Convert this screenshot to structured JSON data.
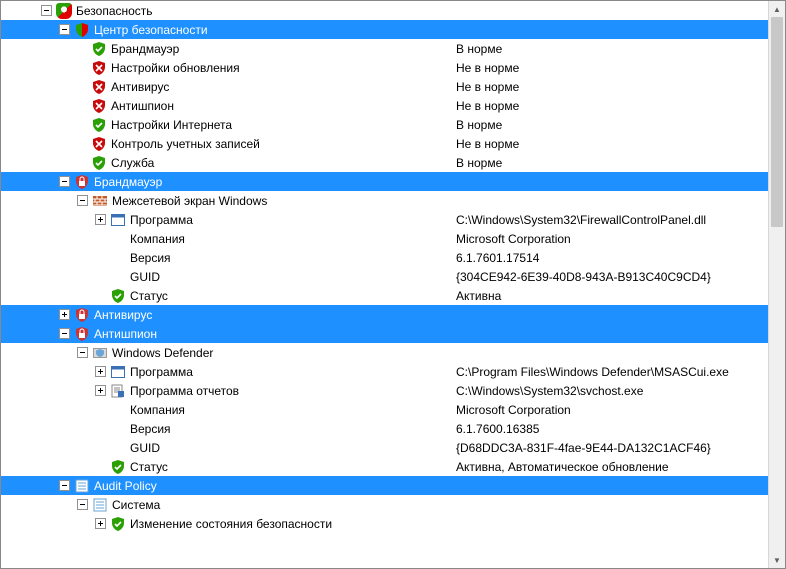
{
  "root": {
    "label": "Безопасность"
  },
  "security_center": {
    "label": "Центр безопасности",
    "items": [
      {
        "label": "Брандмауэр",
        "value": "В норме",
        "ok": true
      },
      {
        "label": "Настройки обновления",
        "value": "Не в норме",
        "ok": false
      },
      {
        "label": "Антивирус",
        "value": "Не в норме",
        "ok": false
      },
      {
        "label": "Антишпион",
        "value": "Не в норме",
        "ok": false
      },
      {
        "label": "Настройки Интернета",
        "value": "В норме",
        "ok": true
      },
      {
        "label": "Контроль учетных записей",
        "value": "Не в норме",
        "ok": false
      },
      {
        "label": "Служба",
        "value": "В норме",
        "ok": true
      }
    ]
  },
  "firewall": {
    "label": "Брандмауэр",
    "provider": {
      "label": "Межсетевой экран Windows"
    },
    "props": [
      {
        "label": "Программа",
        "value": "C:\\Windows\\System32\\FirewallControlPanel.dll",
        "icon": "window"
      },
      {
        "label": "Компания",
        "value": "Microsoft Corporation",
        "icon": "none"
      },
      {
        "label": "Версия",
        "value": "6.1.7601.17514",
        "icon": "none"
      },
      {
        "label": "GUID",
        "value": "{304CE942-6E39-40D8-943A-B913C40C9CD4}",
        "icon": "none"
      },
      {
        "label": "Статус",
        "value": "Активна",
        "icon": "shield-green"
      }
    ]
  },
  "antivirus": {
    "label": "Антивирус"
  },
  "antispy": {
    "label": "Антишпион",
    "provider": {
      "label": "Windows Defender"
    },
    "props": [
      {
        "label": "Программа",
        "value": "C:\\Program Files\\Windows Defender\\MSASCui.exe",
        "icon": "window"
      },
      {
        "label": "Программа отчетов",
        "value": "C:\\Windows\\System32\\svchost.exe",
        "icon": "report"
      },
      {
        "label": "Компания",
        "value": "Microsoft Corporation",
        "icon": "none"
      },
      {
        "label": "Версия",
        "value": "6.1.7600.16385",
        "icon": "none"
      },
      {
        "label": "GUID",
        "value": "{D68DDC3A-831F-4fae-9E44-DA132C1ACF46}",
        "icon": "none"
      },
      {
        "label": "Статус",
        "value": "Активна, Автоматическое обновление",
        "icon": "shield-green"
      }
    ]
  },
  "audit": {
    "label": "Audit Policy",
    "system": {
      "label": "Система"
    },
    "first_item": {
      "label": "Изменение состояния безопасности"
    }
  }
}
